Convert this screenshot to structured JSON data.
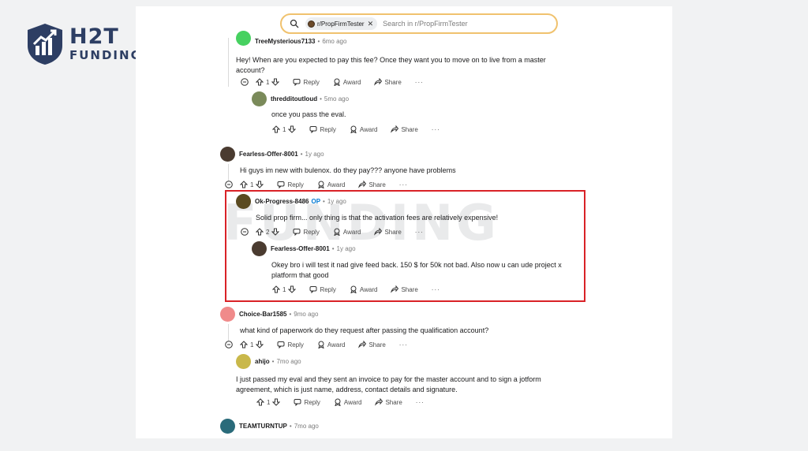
{
  "logo": {
    "main": "H2T",
    "sub": "FUNDING"
  },
  "search": {
    "community": "r/PropFirmTester",
    "placeholder": "Search in r/PropFirmTester"
  },
  "watermark": "FUNDING",
  "labels": {
    "reply": "Reply",
    "award": "Award",
    "share": "Share",
    "more": "···"
  },
  "comments": [
    {
      "user": "TreeMysterious7133",
      "time": "6mo ago",
      "text": "Hey! When are you expected to pay this fee? Once they want you to move on to live from a master account?",
      "votes": "1",
      "avatar_color": "#46d160"
    },
    {
      "user": "thredditoutloud",
      "time": "5mo ago",
      "text": "once you pass the eval.",
      "votes": "1",
      "avatar_color": "#7a8a5a"
    },
    {
      "user": "Fearless-Offer-8001",
      "time": "1y ago",
      "text": "Hi guys im new with bulenox. do they pay??? anyone have problems",
      "votes": "1",
      "avatar_color": "#4a3b30"
    },
    {
      "user": "Ok-Progress-8486",
      "op": "OP",
      "time": "1y ago",
      "text": "Solid prop firm... only thing is that the activation fees are relatively expensive!",
      "votes": "2",
      "avatar_color": "#5a4a20"
    },
    {
      "user": "Fearless-Offer-8001",
      "time": "1y ago",
      "text": "Okey bro i will test it nad give feed back. 150 $ for 50k not bad. Also now u can ude project x platform that good",
      "votes": "1",
      "avatar_color": "#4a3b30"
    },
    {
      "user": "Choice-Bar1585",
      "time": "9mo ago",
      "text": "what kind of paperwork do they request after passing the qualification account?",
      "votes": "1",
      "avatar_color": "#f08a8a"
    },
    {
      "user": "ahijo",
      "time": "7mo ago",
      "text": "I just passed my eval and they sent an invoice to pay for the master account and to sign a jotform agreement, which is just name, address, contact details and signature.",
      "votes": "1",
      "avatar_color": "#c9b84a"
    },
    {
      "user": "TEAMTURNTUP",
      "time": "7mo ago",
      "avatar_color": "#2a6b7a"
    }
  ]
}
